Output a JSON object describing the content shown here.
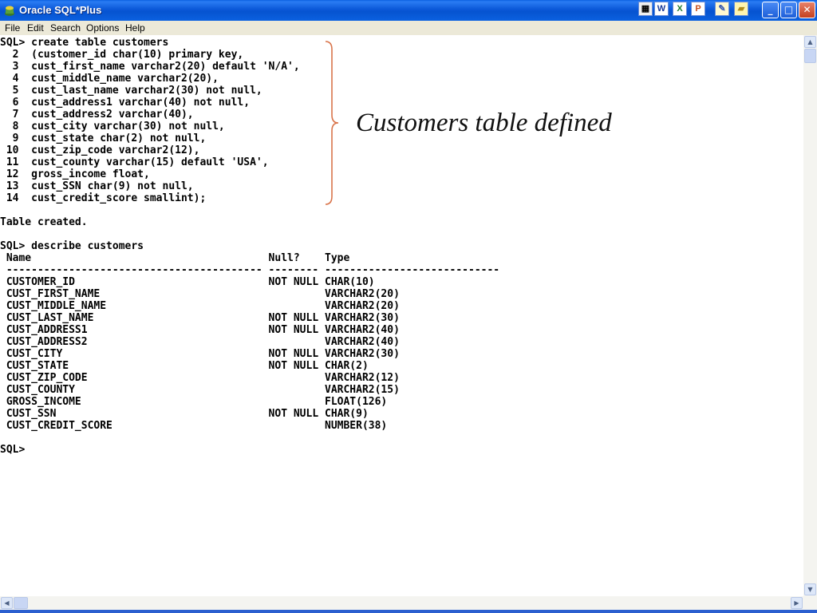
{
  "window": {
    "title": "Oracle SQL*Plus"
  },
  "tray_icons": [
    "notes-icon",
    "word-icon",
    "excel-icon",
    "powerpoint-icon",
    "notepad-icon",
    "folder-icon"
  ],
  "window_controls": {
    "minimize": "_",
    "maximize": "□",
    "close": "✕"
  },
  "menu": [
    "File",
    "Edit",
    "Search",
    "Options",
    "Help"
  ],
  "console": {
    "create_lines": [
      "SQL> create table customers",
      "  2  (customer_id char(10) primary key,",
      "  3  cust_first_name varchar2(20) default 'N/A',",
      "  4  cust_middle_name varchar2(20),",
      "  5  cust_last_name varchar2(30) not null,",
      "  6  cust_address1 varchar(40) not null,",
      "  7  cust_address2 varchar(40),",
      "  8  cust_city varchar(30) not null,",
      "  9  cust_state char(2) not null,",
      " 10  cust_zip_code varchar2(12),",
      " 11  cust_county varchar(15) default 'USA',",
      " 12  gross_income float,",
      " 13  cust_SSN char(9) not null,",
      " 14  cust_credit_score smallint);"
    ],
    "result": "Table created.",
    "describe_command": "SQL> describe customers",
    "describe_header": " Name                                      Null?    Type",
    "describe_separator": " ----------------------------------------- -------- ----------------------------",
    "describe_rows": [
      " CUSTOMER_ID                               NOT NULL CHAR(10)",
      " CUST_FIRST_NAME                                    VARCHAR2(20)",
      " CUST_MIDDLE_NAME                                   VARCHAR2(20)",
      " CUST_LAST_NAME                            NOT NULL VARCHAR2(30)",
      " CUST_ADDRESS1                             NOT NULL VARCHAR2(40)",
      " CUST_ADDRESS2                                      VARCHAR2(40)",
      " CUST_CITY                                 NOT NULL VARCHAR2(30)",
      " CUST_STATE                                NOT NULL CHAR(2)",
      " CUST_ZIP_CODE                                      VARCHAR2(12)",
      " CUST_COUNTY                                        VARCHAR2(15)",
      " GROSS_INCOME                                       FLOAT(126)",
      " CUST_SSN                                  NOT NULL CHAR(9)",
      " CUST_CREDIT_SCORE                                  NUMBER(38)"
    ],
    "prompt": "SQL>"
  },
  "annotation": {
    "text": "Customers table defined",
    "brace_color": "#d9744a"
  },
  "colors": {
    "titlebar": "#0a5fe0",
    "console_bg": "#ffffff",
    "text": "#000000"
  }
}
